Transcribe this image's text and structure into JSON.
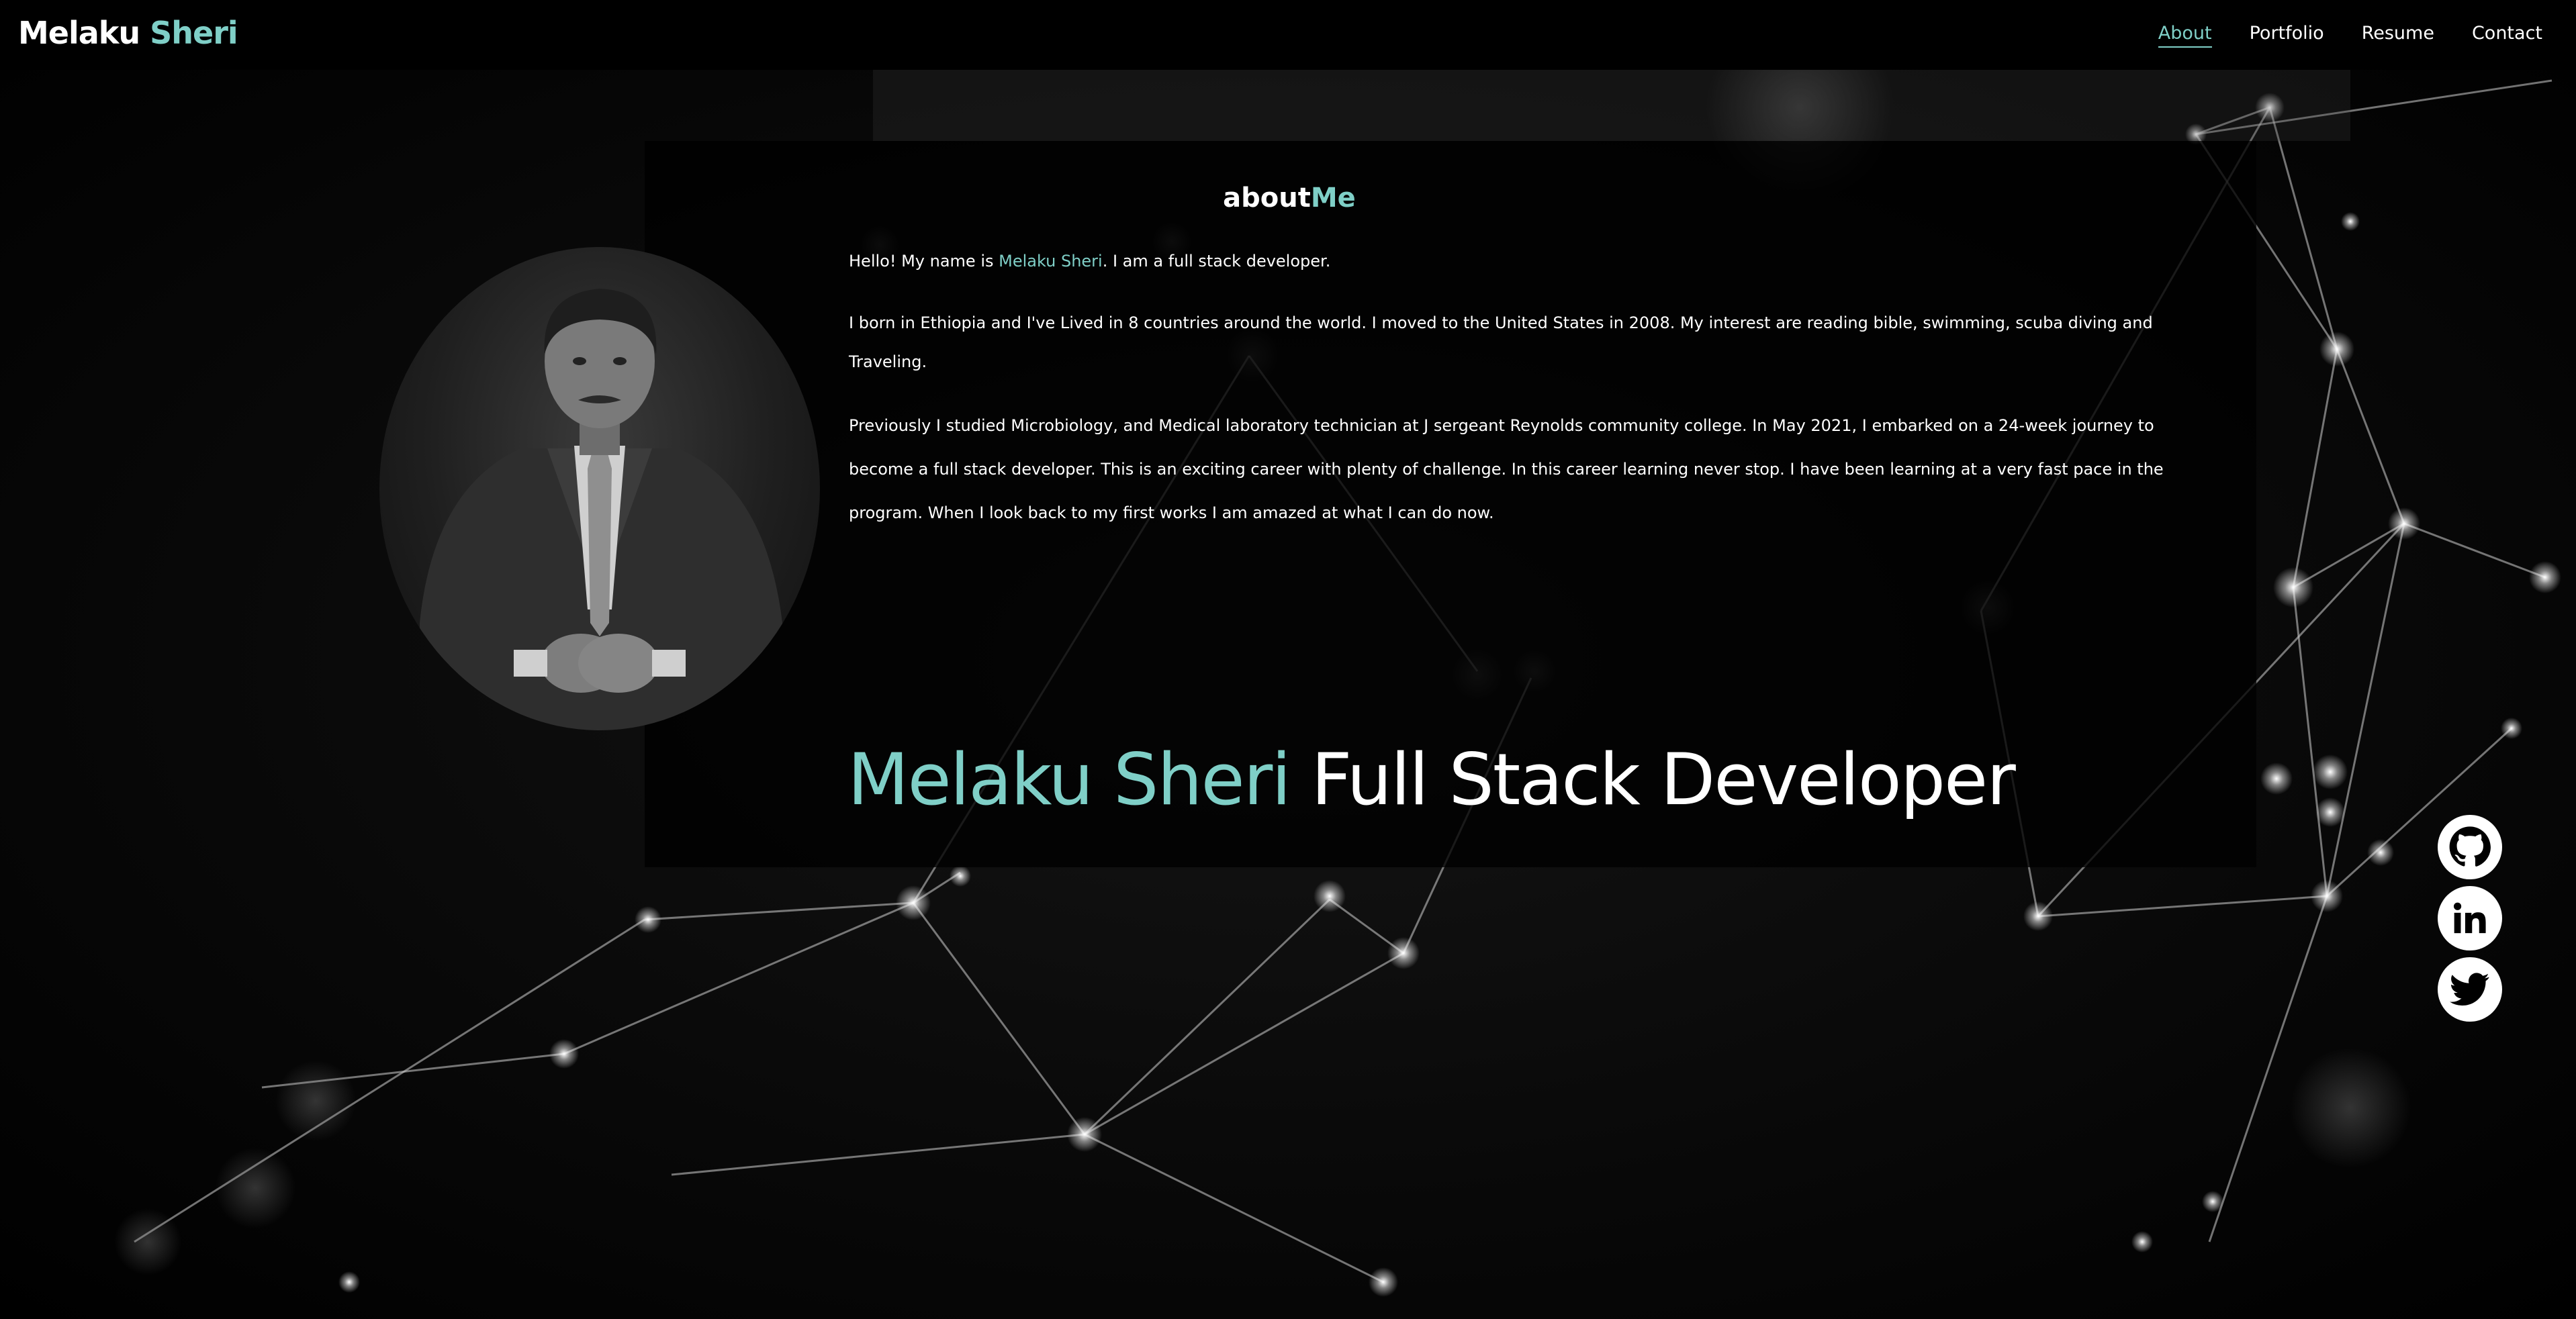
{
  "header": {
    "brand_first": "Melaku",
    "brand_second": "Sheri",
    "nav": [
      {
        "label": "About",
        "active": true
      },
      {
        "label": "Portfolio",
        "active": false
      },
      {
        "label": "Resume",
        "active": false
      },
      {
        "label": "Contact",
        "active": false
      }
    ]
  },
  "about": {
    "title_main": "about",
    "title_accent": "Me",
    "p1_before": "Hello! My name is",
    "p1_name": "Melaku Sheri",
    "p1_after": ". I am a full stack developer.",
    "p2": "I born in Ethiopia and I've Lived in 8 countries around the world. I moved to the United States in 2008. My interest are reading bible, swimming, scuba diving and Traveling.",
    "p3": "Previously I studied Microbiology, and Medical laboratory technician at J sergeant Reynolds community college. In May 2021, I embarked on a 24-week journey to become a full stack developer. This is an exciting career with plenty of challenge. In this career learning never stop. I have been learning at a very fast pace in the program. When I look back to my first works I am amazed at what I can do now."
  },
  "headline": {
    "name": "Melaku Sheri",
    "role": "Full Stack Developer"
  },
  "social": {
    "icons": [
      "github-icon",
      "linkedin-icon",
      "twitter-icon"
    ]
  },
  "colors": {
    "accent": "#7fcfc7",
    "background": "#000000",
    "text": "#ffffff"
  }
}
